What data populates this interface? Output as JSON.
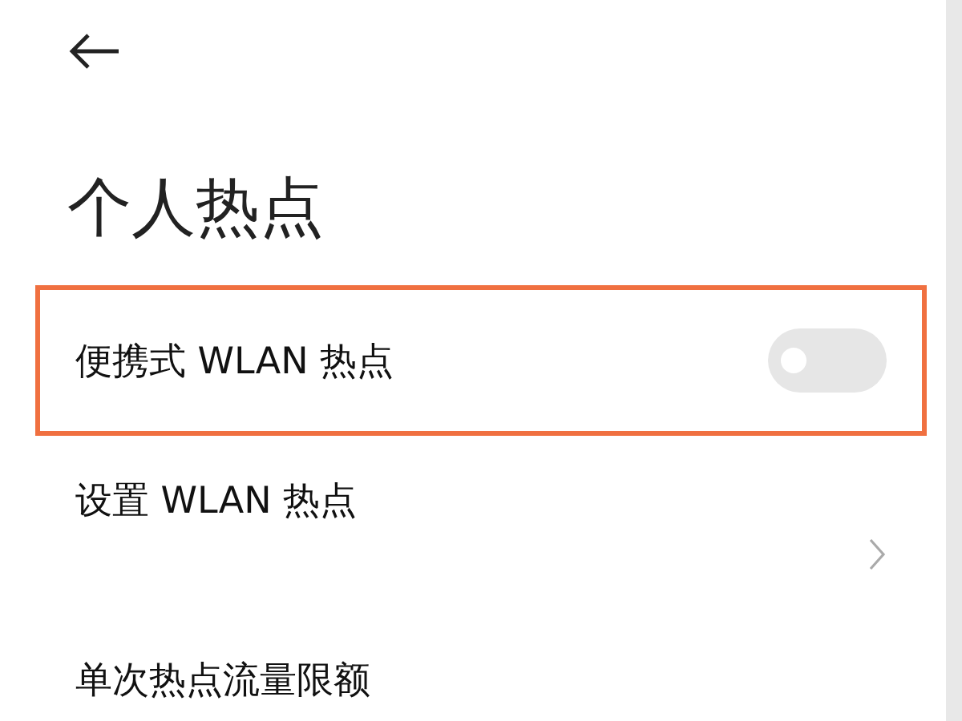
{
  "title": "个人热点",
  "items": [
    {
      "kind": "toggle",
      "label": "便携式 WLAN 热点",
      "on": false,
      "highlighted": true
    },
    {
      "kind": "link",
      "label": "设置 WLAN 热点",
      "highlighted": false
    },
    {
      "kind": "link_cut",
      "label": "单次热点流量限额",
      "highlighted": false
    }
  ]
}
